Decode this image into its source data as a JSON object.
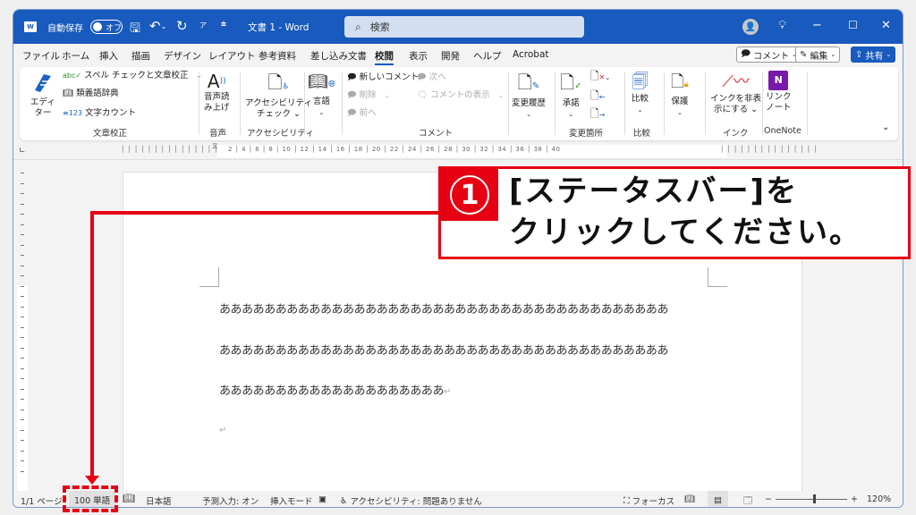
{
  "titlebar": {
    "autosave_label": "自動保存",
    "autosave_state": "オフ",
    "doc_title": "文書 1  -  Word",
    "search_placeholder": "検索",
    "minimize": "−",
    "maximize": "☐",
    "close": "✕"
  },
  "menu": {
    "tabs": [
      "ファイル",
      "ホーム",
      "挿入",
      "描画",
      "デザイン",
      "レイアウト",
      "参考資料",
      "差し込み文書",
      "校閲",
      "表示",
      "開発",
      "ヘルプ",
      "Acrobat"
    ],
    "active_tab": "校閲",
    "comment_button": "コメント",
    "edit_button": "編集",
    "share_button": "共有"
  },
  "ribbon": {
    "proofing": {
      "editor": "エディ\nター",
      "spelling": "スペル チェックと文章校正",
      "thesaurus": "類義語辞典",
      "word_count": "文字カウント",
      "group": "文章校正"
    },
    "speech": {
      "read_aloud_1": "音声読",
      "read_aloud_2": "み上げ",
      "group": "音声"
    },
    "accessibility": {
      "check_1": "アクセシビリティ",
      "check_2": "チェック ⌄",
      "group": "アクセシビリティ"
    },
    "language": {
      "label": "言語"
    },
    "comments": {
      "new": "新しいコメント",
      "delete": "削除",
      "prev": "前へ",
      "next": "次へ",
      "show": "コメントの表示",
      "group": "コメント"
    },
    "tracking": {
      "label": "変更履歴"
    },
    "changes": {
      "accept": "承諾",
      "group": "変更箇所"
    },
    "compare": {
      "label": "比較",
      "group": "比較"
    },
    "protect": {
      "label": "保護"
    },
    "ink": {
      "hide_1": "インクを非表",
      "hide_2": "示にする ⌄",
      "group": "インク"
    },
    "onenote": {
      "link_1": "リンク",
      "link_2": "ノート",
      "group": "OneNote"
    }
  },
  "ruler": {
    "h_numbers": "2  │  4  │  6  │  8  │ 10 │ 12 │ 14 │ 16 │ 18 │ 20 │ 22 │ 24 │ 26 │ 28 │ 30 │ 32 │ 34 │ 36 │ 38 │ 40"
  },
  "document": {
    "lines": [
      "ああああああああああああああああああああああああああああああああああああああああ",
      "ああああああああああああああああああああああああああああああああああああああああ",
      "ああああああああああああああああああああ"
    ],
    "para_mark": "↵"
  },
  "statusbar": {
    "page": "1/1 ページ",
    "words": "100 単語",
    "language": "日本語",
    "predictive": "予測入力: オン",
    "insert_mode": "挿入モード",
    "accessibility": "アクセシビリティ: 問題ありません",
    "focus": "フォーカス",
    "zoom_minus": "−",
    "zoom_plus": "+",
    "zoom_level": "120%",
    "zoom_percent": 120
  },
  "annotation": {
    "step_number": "①",
    "line1": "[ステータスバー]を",
    "line2": "クリックしてください。",
    "color": "#e60012"
  }
}
